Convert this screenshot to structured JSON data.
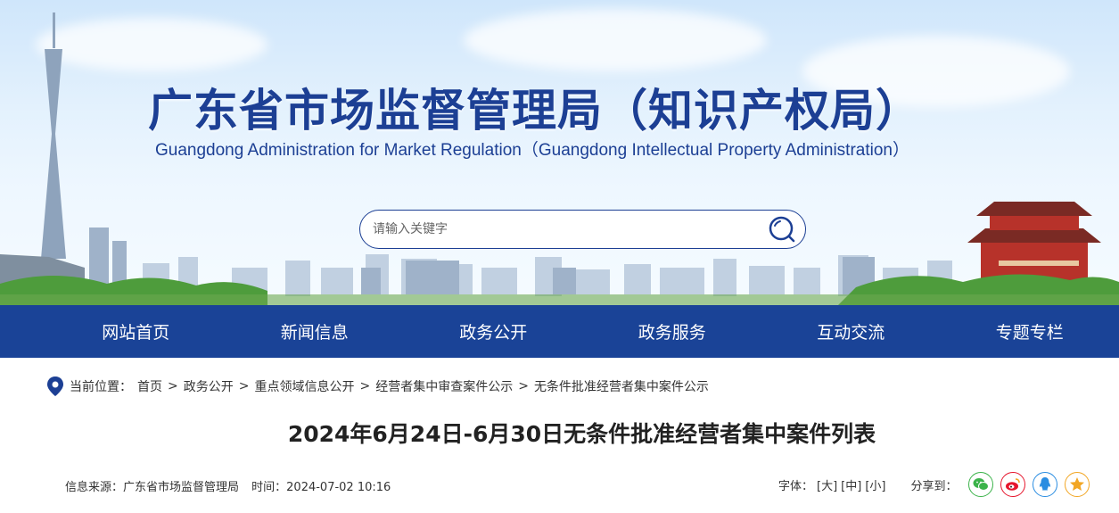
{
  "header": {
    "title": "广东省市场监督管理局（知识产权局）",
    "subtitle": "Guangdong Administration for Market Regulation（Guangdong Intellectual Property Administration）"
  },
  "search": {
    "placeholder": "请输入关键字",
    "icon": "search-icon"
  },
  "nav": {
    "items": [
      "网站首页",
      "新闻信息",
      "政务公开",
      "政务服务",
      "互动交流",
      "专题专栏"
    ]
  },
  "breadcrumb": {
    "label": "当前位置：",
    "items": [
      "首页",
      "政务公开",
      "重点领域信息公开",
      "经营者集中审查案件公示",
      "无条件批准经营者集中案件公示"
    ],
    "separator": ">"
  },
  "article": {
    "title": "2024年6月24日-6月30日无条件批准经营者集中案件列表",
    "source": "信息来源：广东省市场监督管理局",
    "time": "时间：2024-07-02 10:16"
  },
  "tools": {
    "font_label": "字体：",
    "font_large": "[大]",
    "font_medium": "[中]",
    "font_small": "[小]",
    "share_label": "分享到："
  },
  "share": [
    {
      "icon": "wechat-icon",
      "color": "#3bb34a"
    },
    {
      "icon": "weibo-icon",
      "color": "#e6162d"
    },
    {
      "icon": "qq-icon",
      "color": "#2a8de1"
    },
    {
      "icon": "qzone-icon",
      "color": "#f2a623"
    }
  ],
  "colors": {
    "brand": "#1c3f94",
    "nav_bg": "#1a4397"
  }
}
